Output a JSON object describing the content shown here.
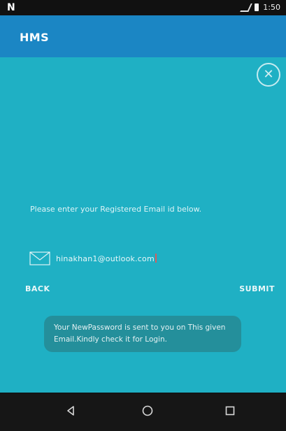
{
  "status_bar": {
    "left_icon": "N",
    "signal_icon": "signal-icon",
    "battery_icon": "battery-icon",
    "time": "1:50"
  },
  "app_bar": {
    "title": "HMS"
  },
  "dialog": {
    "close_icon": "close-icon",
    "prompt": "Please enter your Registered Email id below.",
    "email_icon": "mail-icon",
    "email_value": "hinakhan1@outlook.com",
    "back_label": "BACK",
    "submit_label": "SUBMIT",
    "toast": "Your NewPassword is sent to you on This given Email.Kindly check it for Login."
  },
  "nav_bar": {
    "back_icon": "back-icon",
    "home_icon": "home-icon",
    "recents_icon": "recents-icon"
  },
  "colors": {
    "status_bar_bg": "#111111",
    "app_bar_bg": "#1b86c4",
    "content_bg": "#1fb0c4",
    "toast_bg": "#268a94",
    "nav_bar_bg": "#161616",
    "cursor": "#d45e5e"
  }
}
